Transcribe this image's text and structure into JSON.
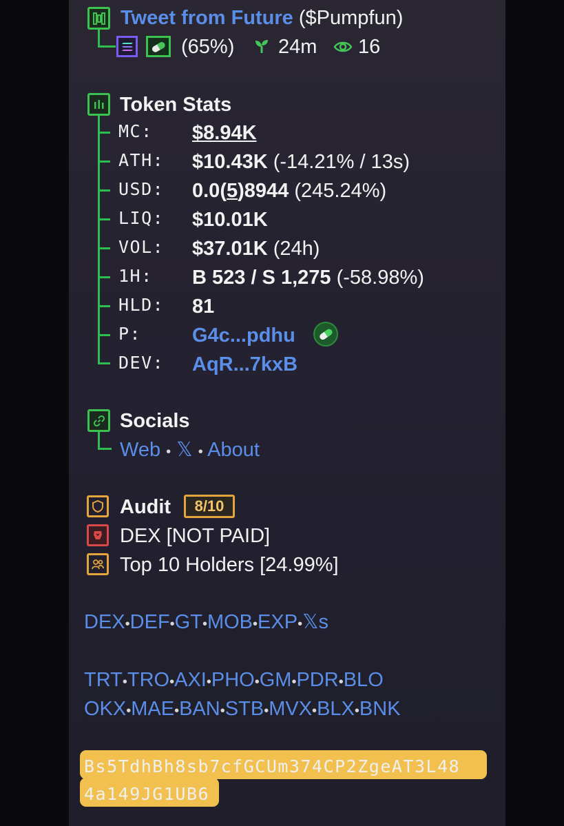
{
  "header": {
    "title": "Tweet from Future",
    "ticker": "($Pumpfun)",
    "percent": "(65%)",
    "age": "24m",
    "views": "16"
  },
  "token_stats": {
    "heading": "Token Stats",
    "rows": [
      {
        "label": "MC:",
        "value": "$8.94K",
        "extra": ""
      },
      {
        "label": "ATH:",
        "value": "$10.43K",
        "extra": "(-14.21% / 13s)"
      },
      {
        "label": "USD:",
        "value_pre": "0.0(",
        "value_sub": "5",
        "value_post": ")8944",
        "extra": "(245.24%)"
      },
      {
        "label": "LIQ:",
        "value": "$10.01K",
        "extra": ""
      },
      {
        "label": "VOL:",
        "value": "$37.01K",
        "extra": "(24h)"
      },
      {
        "label": "1H:",
        "value": "B 523 / S 1,275",
        "extra": "(-58.98%)"
      },
      {
        "label": "HLD:",
        "value": "81",
        "extra": ""
      },
      {
        "label": "P:",
        "value": "G4c...pdhu",
        "extra": ""
      },
      {
        "label": "DEV:",
        "value": "AqR...7kxB",
        "extra": ""
      }
    ]
  },
  "socials": {
    "heading": "Socials",
    "web": "Web",
    "x": "𝕏",
    "about": "About",
    "dot": "•"
  },
  "audit": {
    "heading": "Audit",
    "score": "8/10",
    "dex": "DEX [NOT PAID]",
    "holders": "Top 10 Holders [24.99%]"
  },
  "links_row1": [
    "DEX",
    "DEF",
    "GT",
    "MOB",
    "EXP",
    "𝕏s"
  ],
  "links_row2": [
    "TRT",
    "TRO",
    "AXI",
    "PHO",
    "GM",
    "PDR",
    "BLO"
  ],
  "links_row3": [
    "OKX",
    "MAE",
    "BAN",
    "STB",
    "MVX",
    "BLX",
    "BNK"
  ],
  "address": {
    "line1": "Bs5TdhBh8sb7cfGCUm374CP2ZgeAT3L48",
    "line2": "4a149JG1UB6"
  },
  "colors": {
    "green_accent": "#3cc24f",
    "blue_link": "#5a8ee8",
    "audit_orange": "#e3a53c",
    "danger_red": "#d84a4a",
    "highlight_yellow": "#f2c04f"
  }
}
